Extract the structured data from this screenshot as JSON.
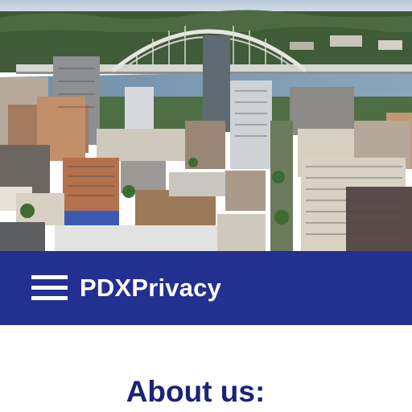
{
  "header": {
    "brand": "PDXPrivacy",
    "menu_icon": "hamburger-menu-icon",
    "background_color": "#22308f"
  },
  "hero": {
    "description_icon": "city-skyline-photo"
  },
  "main": {
    "section_title": "About us:",
    "title_color": "#1a2476"
  }
}
